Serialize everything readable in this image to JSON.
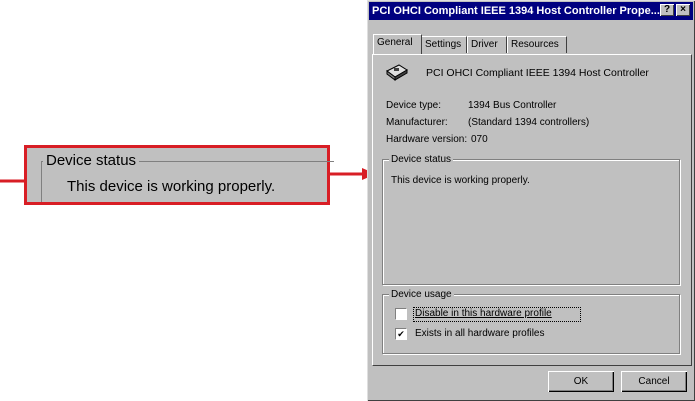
{
  "callout": {
    "legend": "Device status",
    "text": "This device is working properly."
  },
  "dialog": {
    "title": "PCI OHCI Compliant IEEE 1394 Host Controller Prope...",
    "title_buttons": [
      "?",
      "×"
    ],
    "tabs": [
      "General",
      "Settings",
      "Driver",
      "Resources"
    ],
    "active_tab": "General",
    "device_icon": "device-card-icon",
    "device_name": "PCI OHCI Compliant IEEE 1394 Host Controller",
    "fields": [
      {
        "label": "Device type:",
        "value": "1394 Bus Controller"
      },
      {
        "label": "Manufacturer:",
        "value": "(Standard 1394 controllers)"
      },
      {
        "label": "Hardware version:",
        "value": "070"
      }
    ],
    "device_status": {
      "legend": "Device status",
      "text": "This device is working properly."
    },
    "device_usage": {
      "legend": "Device usage",
      "options": [
        {
          "label": "Disable in this hardware profile",
          "checked": false
        },
        {
          "label": "Exists in all hardware profiles",
          "checked": true
        }
      ]
    },
    "buttons": {
      "ok": "OK",
      "cancel": "Cancel"
    }
  },
  "colors": {
    "callout_border": "#d81e25",
    "window_face": "#c0c0c0",
    "titlebar": "#000080"
  }
}
